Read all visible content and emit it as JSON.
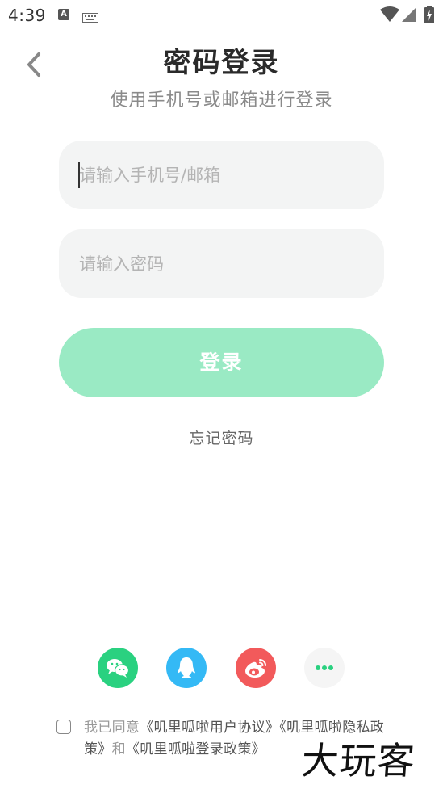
{
  "status_bar": {
    "time": "4:39",
    "a_icon_text": "A",
    "icons": [
      "notification-a-icon",
      "keyboard-icon",
      "wifi-icon",
      "signal-icon",
      "battery-charging-icon"
    ]
  },
  "header": {
    "back_icon": "chevron-left-icon",
    "title": "密码登录",
    "subtitle": "使用手机号或邮箱进行登录"
  },
  "form": {
    "phone_placeholder": "请输入手机号/邮箱",
    "password_placeholder": "请输入密码",
    "login_label": "登录",
    "forgot_label": "忘记密码"
  },
  "social": [
    {
      "name": "wechat-icon",
      "color": "#2ad180"
    },
    {
      "name": "qq-icon",
      "color": "#34b9f5"
    },
    {
      "name": "weibo-icon",
      "color": "#f25a5b"
    },
    {
      "name": "more-icon",
      "color": "#f5f5f5"
    }
  ],
  "agreement": {
    "prefix": "我已同意",
    "user_agreement": "《叽里呱啦用户协议》",
    "privacy_policy": "《叽里呱啦隐私政策》",
    "joiner": "和",
    "login_policy": "《叽里呱啦登录政策》"
  },
  "watermark": "大玩客",
  "colors": {
    "login_button": "#9aeac4",
    "input_background": "#f3f4f4"
  }
}
